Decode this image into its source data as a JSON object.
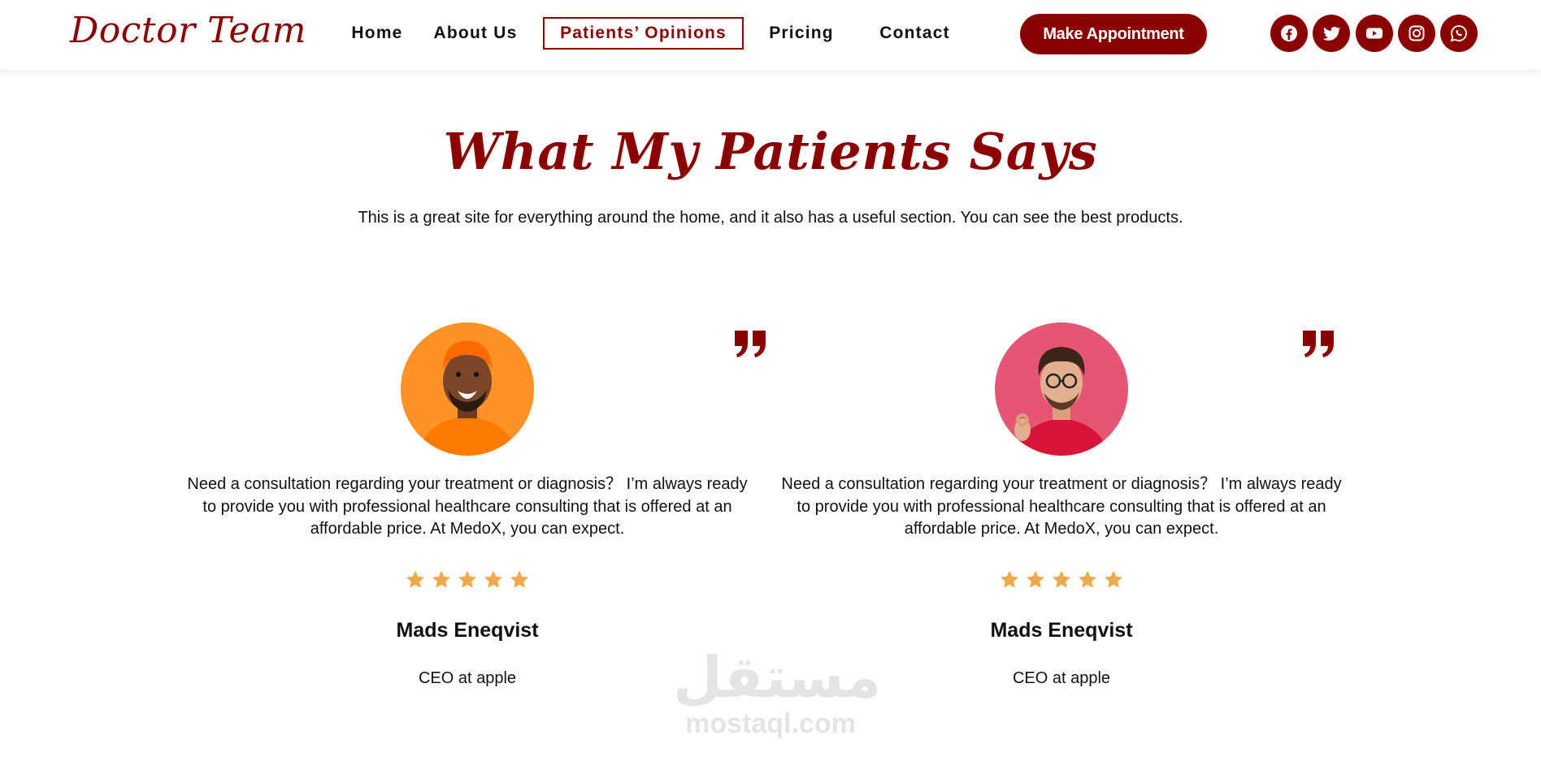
{
  "brand": {
    "logo_text": "Doctor Team",
    "accent_color": "#8b0000",
    "star_color": "#f0a94a"
  },
  "nav": {
    "items": [
      {
        "label": "Home",
        "active": false
      },
      {
        "label": "About Us",
        "active": false
      },
      {
        "label": "Patients’ Opinions",
        "active": true
      },
      {
        "label": "Pricing",
        "active": false
      },
      {
        "label": "Contact",
        "active": false
      }
    ],
    "cta_label": "Make Appointment",
    "social_icons": [
      "facebook-icon",
      "twitter-icon",
      "youtube-icon",
      "instagram-icon",
      "whatsapp-icon"
    ]
  },
  "section": {
    "title": "What My Patients Says",
    "subtitle": "This is a great site for everything around the home, and it also has a useful section. You can see the best products."
  },
  "testimonials": [
    {
      "text": "Need a consultation regarding your treatment or diagnosis？ I’m always ready to provide you with professional healthcare consulting that is offered at an affordable price. At MedoX, you can expect.",
      "rating": 5,
      "name": "Mads Eneqvist",
      "role": "CEO at apple",
      "avatar_bg": "#ff8c1a"
    },
    {
      "text": "Need a consultation regarding your treatment or diagnosis？ I’m always ready to provide you with professional healthcare consulting that is offered at an affordable price. At MedoX, you can expect.",
      "rating": 5,
      "name": "Mads Eneqvist",
      "role": "CEO at apple",
      "avatar_bg": "#e0506e"
    }
  ],
  "watermark": {
    "arabic": "مستقل",
    "latin": "mostaql.com"
  }
}
